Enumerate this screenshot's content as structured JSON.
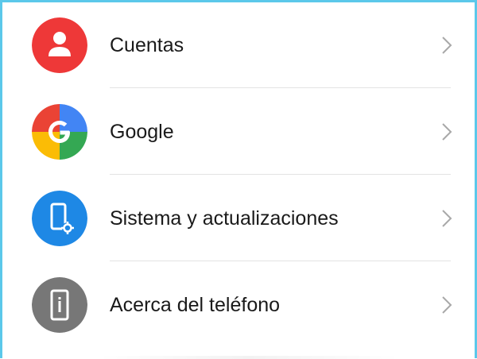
{
  "settings": {
    "items": [
      {
        "label": "Cuentas",
        "icon": "user-icon",
        "icon_color": "#ee3838"
      },
      {
        "label": "Google",
        "icon": "google-icon",
        "icon_color": "#4285f4"
      },
      {
        "label": "Sistema y actualizaciones",
        "icon": "phone-settings-icon",
        "icon_color": "#1e88e5"
      },
      {
        "label": "Acerca del teléfono",
        "icon": "phone-info-icon",
        "icon_color": "#777777"
      }
    ]
  },
  "colors": {
    "frame_border": "#5bc8ea",
    "divider": "#e3e3e3",
    "text": "#1a1a1a",
    "chevron": "#a8a8a8"
  }
}
